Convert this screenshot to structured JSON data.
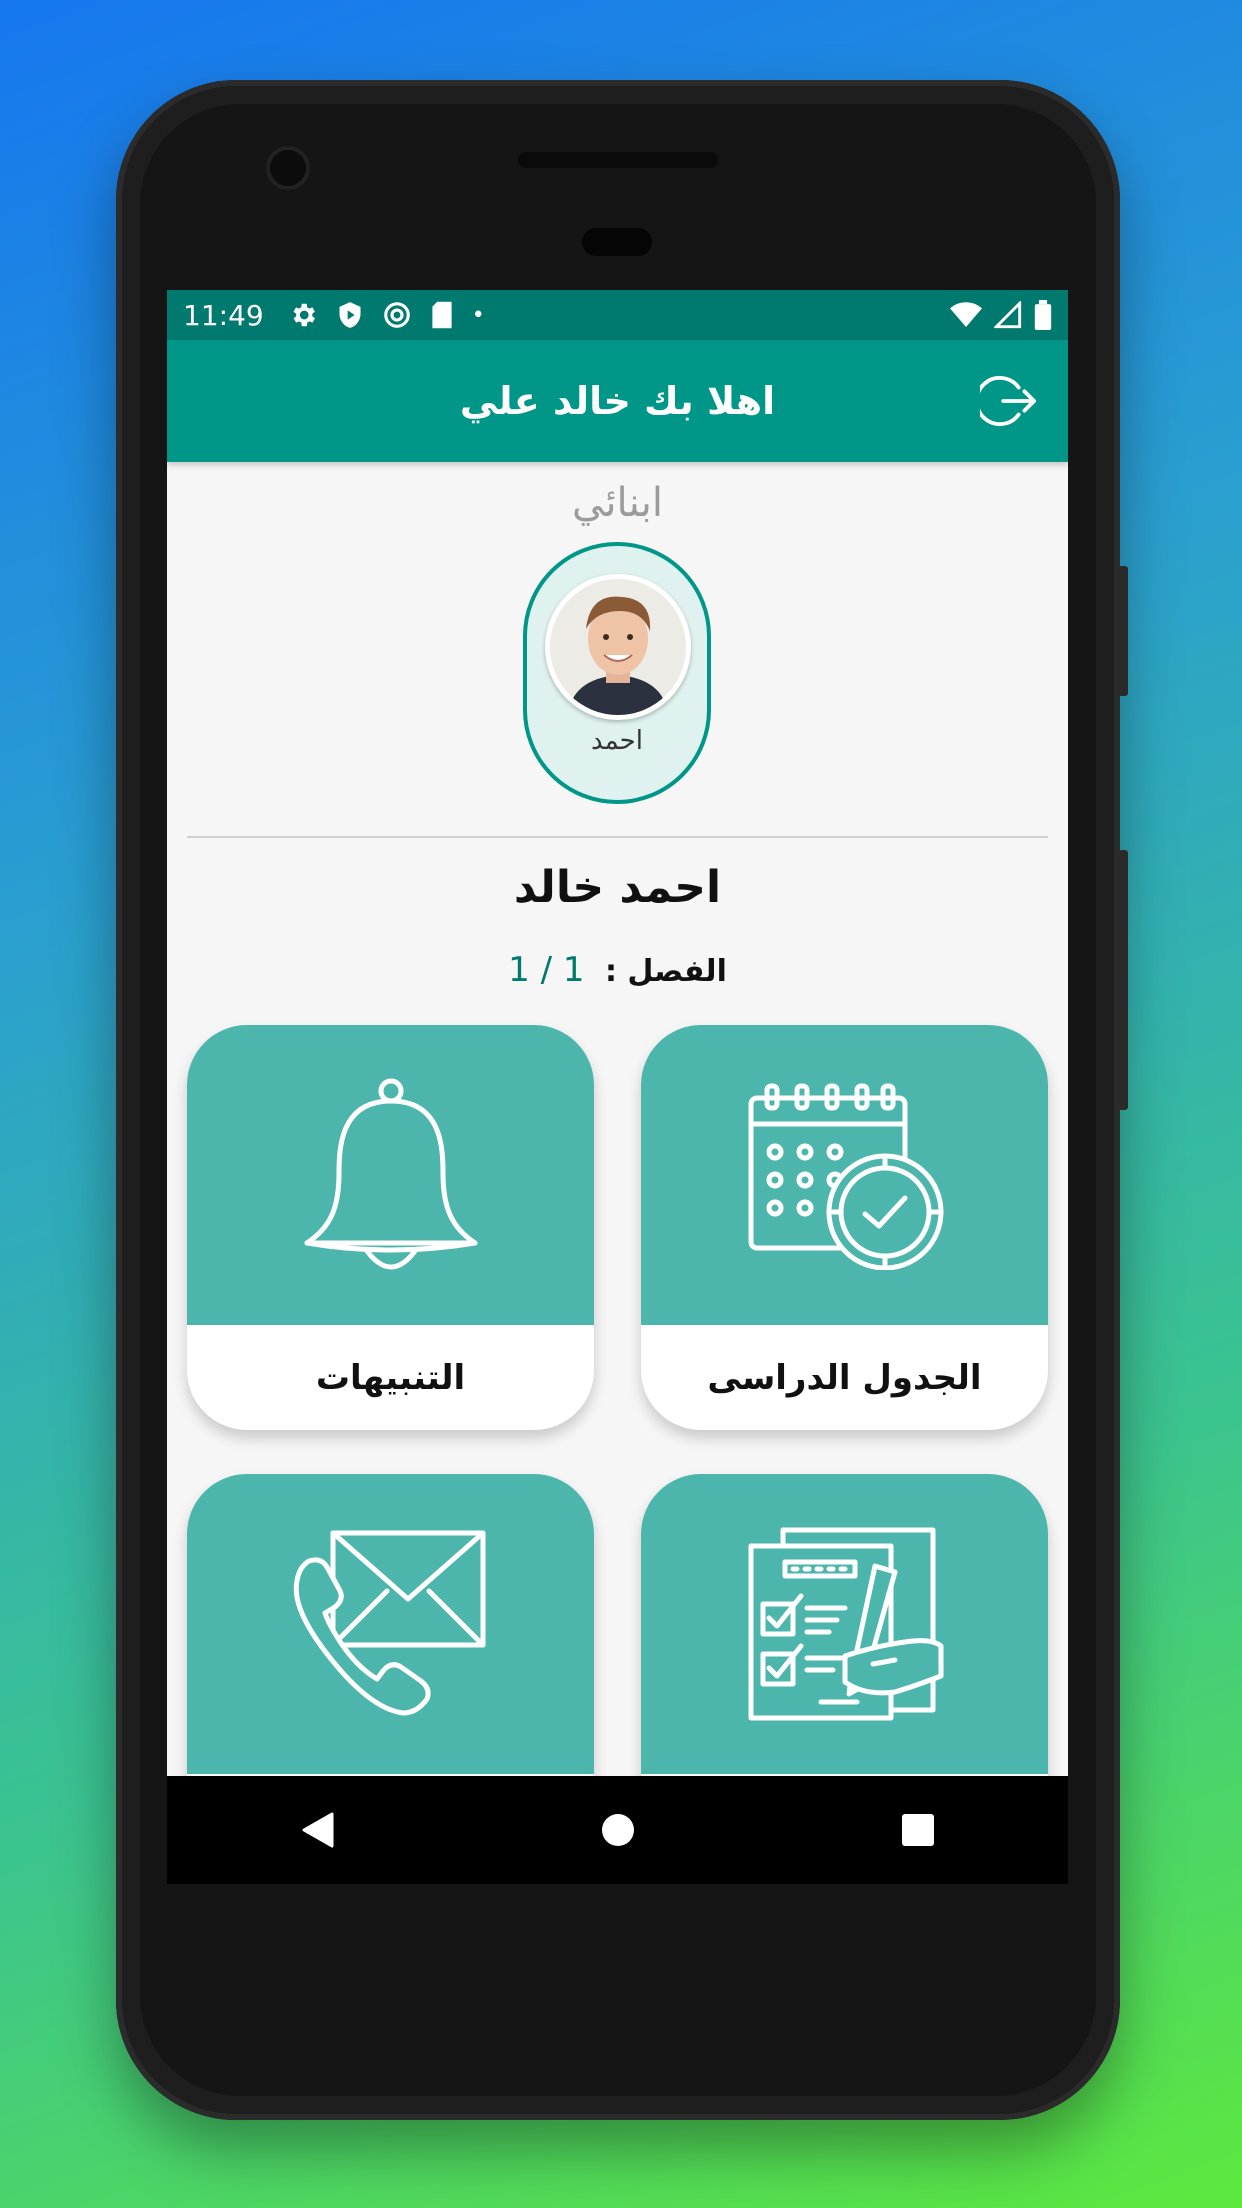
{
  "status_bar": {
    "time": "11:49"
  },
  "app_bar": {
    "title": "اهلا بك خالد علي",
    "logout_icon": "logout-icon"
  },
  "children_section": {
    "label": "ابنائي"
  },
  "selected_child": {
    "name": "احمد"
  },
  "student": {
    "full_name": "احمد خالد",
    "class_label": "الفصل :",
    "class_value": "1 / 1"
  },
  "tiles": [
    {
      "label": "الجدول الدراسى",
      "icon": "calendar-clock-icon"
    },
    {
      "label": "التنبيهات",
      "icon": "bell-icon"
    },
    {
      "label": "",
      "icon": "checklist-icon"
    },
    {
      "label": "",
      "icon": "mail-phone-icon"
    }
  ],
  "colors": {
    "primary": "#009688",
    "status": "#00796e",
    "tile": "#4db6ac"
  }
}
